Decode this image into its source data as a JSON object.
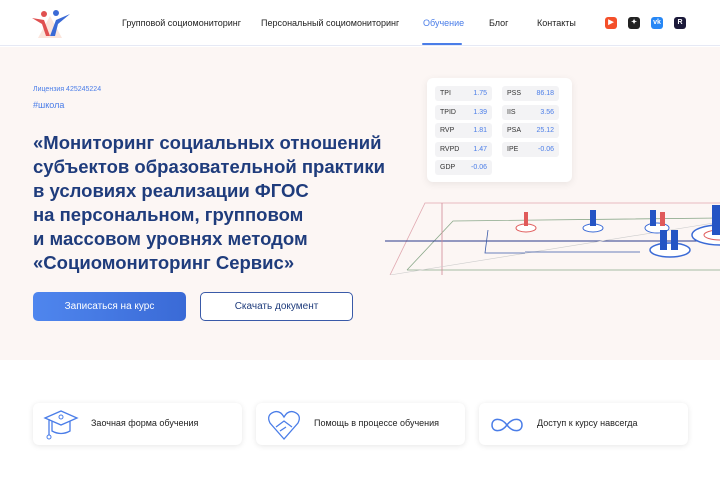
{
  "nav": {
    "items": [
      "Групповой социомониторинг",
      "Персональный социомониторинг",
      "Обучение",
      "Блог",
      "Контакты"
    ],
    "active": "Обучение"
  },
  "social": [
    {
      "name": "youtube",
      "color": "#f4502a",
      "glyph": "▶"
    },
    {
      "name": "dzen",
      "color": "#222222",
      "glyph": "✦"
    },
    {
      "name": "vk",
      "color": "#2787f5",
      "glyph": "vk"
    },
    {
      "name": "rutube",
      "color": "#1c1a3a",
      "glyph": "R"
    }
  ],
  "hero": {
    "license": "Лицензия 425245224",
    "tag": "#школа",
    "title_lines": [
      "«Мониторинг социальных отношений",
      "субъектов образовательной практики",
      "в условиях реализации ФГОС",
      "на персональном, групповом",
      "и массовом уровнях методом",
      "«Социомониторинг Сервис»"
    ],
    "primary_button": "Записаться на курс",
    "secondary_button": "Скачать документ"
  },
  "metrics": [
    {
      "k": "TPI",
      "v": "1.75"
    },
    {
      "k": "PSS",
      "v": "86.18"
    },
    {
      "k": "TPID",
      "v": "1.39"
    },
    {
      "k": "IIS",
      "v": "3.56"
    },
    {
      "k": "RVP",
      "v": "1.81"
    },
    {
      "k": "PSA",
      "v": "25.12"
    },
    {
      "k": "RVPD",
      "v": "1.47"
    },
    {
      "k": "IPE",
      "v": "-0.06"
    },
    {
      "k": "GDP",
      "v": "-0.06"
    }
  ],
  "features": [
    {
      "label": "Заочная форма обучения",
      "icon": "graduation-cap"
    },
    {
      "label": "Помощь в процессе обучения",
      "icon": "heart-handshake"
    },
    {
      "label": "Доступ к курсу навсегда",
      "icon": "infinity"
    }
  ]
}
